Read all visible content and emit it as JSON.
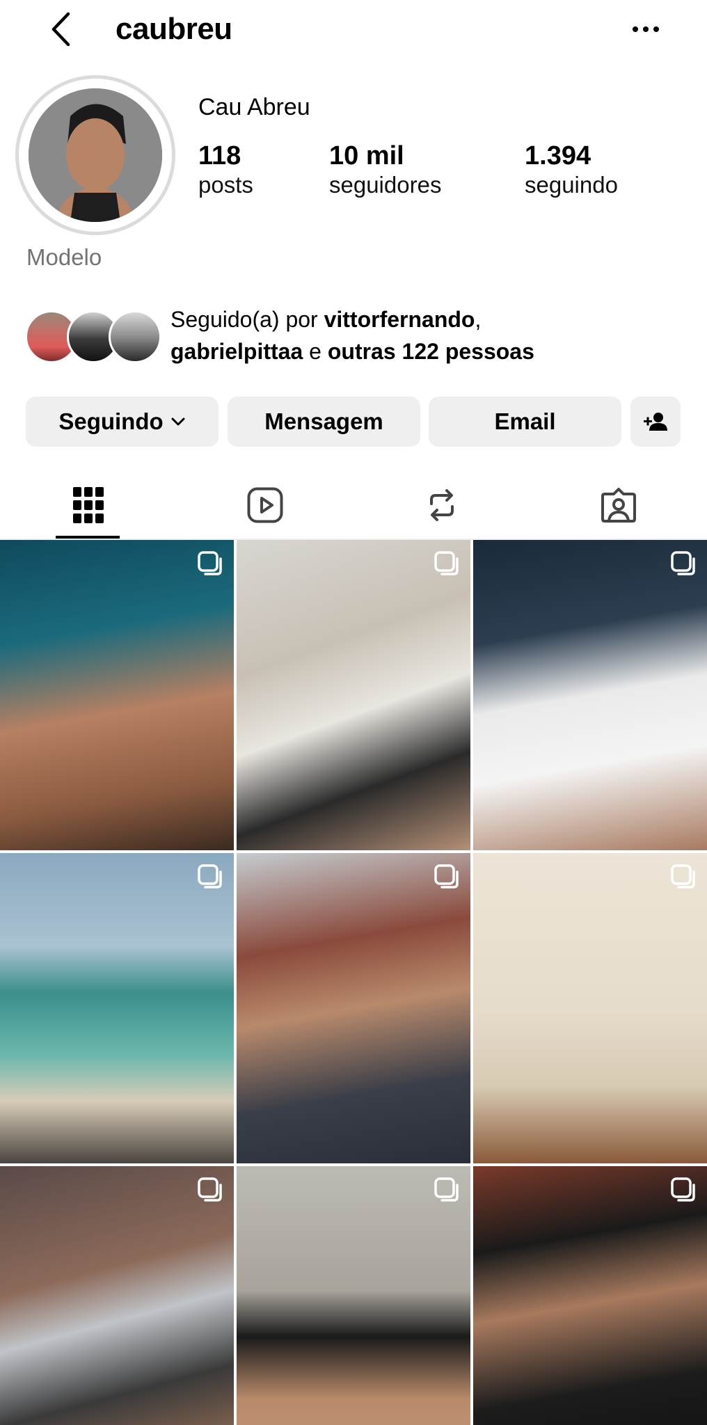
{
  "header": {
    "username": "caubreu",
    "back_icon": "chevron-left-icon",
    "more_icon": "more-horizontal-icon"
  },
  "profile": {
    "display_name": "Cau Abreu",
    "category": "Modelo",
    "stats": {
      "posts": {
        "value": "118",
        "label": "posts"
      },
      "followers": {
        "value": "10 mil",
        "label": "seguidores"
      },
      "following": {
        "value": "1.394",
        "label": "seguindo"
      }
    }
  },
  "followed_by": {
    "prefix": "Seguido(a) por ",
    "user1": "vittorfernando",
    "sep": ",",
    "user2": "gabrielpittaa",
    "conj": " e ",
    "others": "outras 122 pessoas"
  },
  "actions": {
    "following_label": "Seguindo",
    "message_label": "Mensagem",
    "email_label": "Email",
    "add_user_icon": "add-person-icon"
  },
  "tabs": [
    {
      "name": "grid",
      "icon": "grid-icon",
      "active": true
    },
    {
      "name": "reels",
      "icon": "reels-icon",
      "active": false
    },
    {
      "name": "reposts",
      "icon": "repost-icon",
      "active": false
    },
    {
      "name": "tagged",
      "icon": "tagged-icon",
      "active": false
    }
  ],
  "posts": [
    {
      "type": "carousel"
    },
    {
      "type": "carousel"
    },
    {
      "type": "carousel"
    },
    {
      "type": "carousel"
    },
    {
      "type": "carousel"
    },
    {
      "type": "carousel"
    },
    {
      "type": "carousel"
    },
    {
      "type": "carousel"
    },
    {
      "type": "carousel"
    }
  ],
  "colors": {
    "button_bg": "#efefef",
    "secondary_text": "#737373",
    "avatar_ring": "#dbdbdb"
  }
}
